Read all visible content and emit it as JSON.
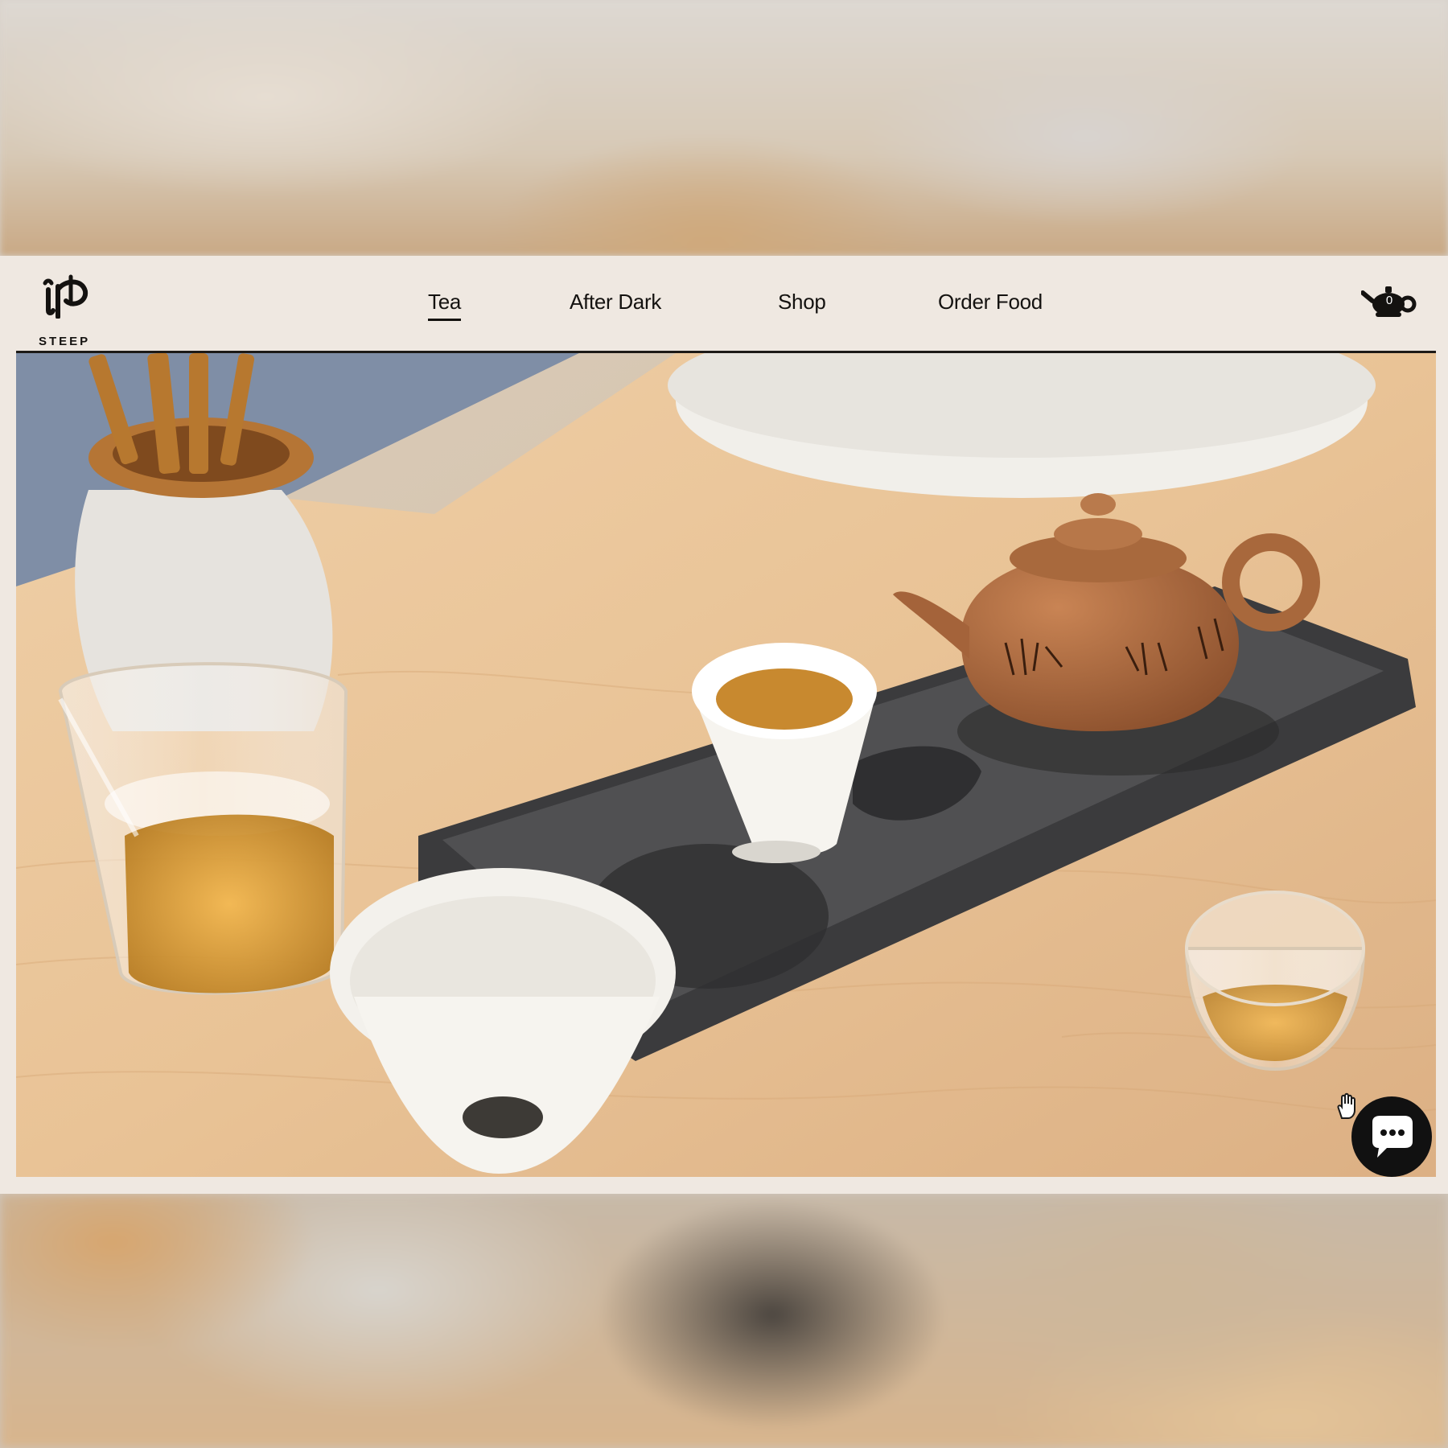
{
  "brand": {
    "logo_icon": "steep-logo-mark",
    "name": "STEEP"
  },
  "nav": {
    "items": [
      {
        "label": "Tea",
        "active": true
      },
      {
        "label": "After Dark",
        "active": false
      },
      {
        "label": "Shop",
        "active": false
      },
      {
        "label": "Order Food",
        "active": false
      }
    ]
  },
  "cart": {
    "icon": "teapot-cart-icon",
    "count": "0"
  },
  "hero": {
    "image": "tea-service-on-wooden-table-photo"
  },
  "chat": {
    "icon": "chat-bubble-icon"
  },
  "colors": {
    "header_bg": "#efe8e1",
    "text": "#141210",
    "chat_bg": "#111111"
  }
}
